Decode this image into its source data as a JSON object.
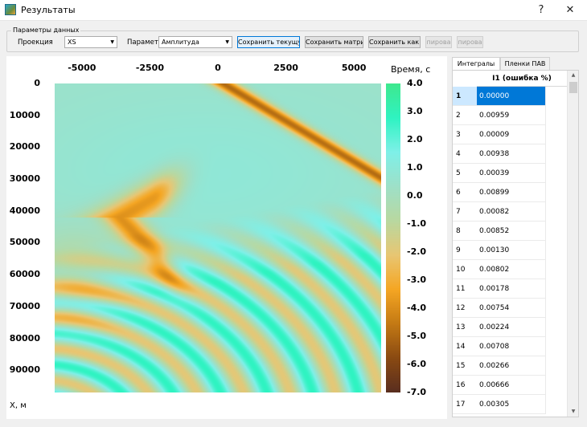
{
  "window": {
    "title": "Результаты",
    "help_btn": "?",
    "close_btn": "✕"
  },
  "params": {
    "group_title": "Параметры данных",
    "projection_label": "Проекция",
    "projection_value": "XS",
    "parameter_label": "Параметр",
    "parameter_value": "Амплитуда",
    "buttons": [
      "Сохранить текущую",
      "Сохранить матрицу",
      "Сохранить как начал",
      "пирова",
      "пирова"
    ]
  },
  "chart_data": {
    "type": "heatmap",
    "title": "",
    "xlabel": "X, м",
    "x_ticks": [
      "-5000",
      "-2500",
      "0",
      "2500",
      "5000"
    ],
    "y_ticks": [
      "0",
      "10000",
      "20000",
      "30000",
      "40000",
      "50000",
      "60000",
      "70000",
      "80000",
      "90000"
    ],
    "xlim": [
      -6000,
      6000
    ],
    "ylim": [
      0,
      97000
    ],
    "colorbar_label": "Время, с",
    "colorbar_ticks": [
      "4.0",
      "3.0",
      "2.0",
      "1.0",
      "0.0",
      "-1.0",
      "-2.0",
      "-3.0",
      "-4.0",
      "-5.0",
      "-6.0",
      "-7.0"
    ],
    "colorbar_range": [
      -7.0,
      4.0
    ],
    "colors": [
      "#5a2e1f",
      "#8a4a12",
      "#c47a14",
      "#f5a623",
      "#e8c673",
      "#b9d8a0",
      "#9ee0c8",
      "#7ff0e8",
      "#2ff3c2",
      "#3ee88f"
    ]
  },
  "tabs": [
    "Интегралы",
    "Пленки ПАВ"
  ],
  "table": {
    "column_header": "I1 (ошибка %)",
    "rows": [
      {
        "n": "1",
        "v": "0.00000"
      },
      {
        "n": "2",
        "v": "0.00959"
      },
      {
        "n": "3",
        "v": "0.00009"
      },
      {
        "n": "4",
        "v": "0.00938"
      },
      {
        "n": "5",
        "v": "0.00039"
      },
      {
        "n": "6",
        "v": "0.00899"
      },
      {
        "n": "7",
        "v": "0.00082"
      },
      {
        "n": "8",
        "v": "0.00852"
      },
      {
        "n": "9",
        "v": "0.00130"
      },
      {
        "n": "10",
        "v": "0.00802"
      },
      {
        "n": "11",
        "v": "0.00178"
      },
      {
        "n": "12",
        "v": "0.00754"
      },
      {
        "n": "13",
        "v": "0.00224"
      },
      {
        "n": "14",
        "v": "0.00708"
      },
      {
        "n": "15",
        "v": "0.00266"
      },
      {
        "n": "16",
        "v": "0.00666"
      },
      {
        "n": "17",
        "v": "0.00305"
      }
    ]
  }
}
